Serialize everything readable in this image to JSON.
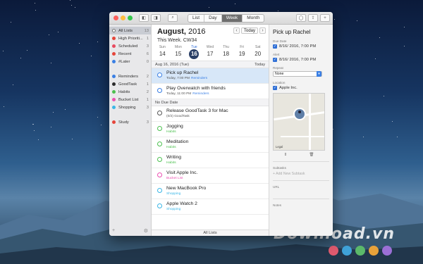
{
  "window": {
    "view_tabs": [
      "List",
      "Day",
      "Week",
      "Month"
    ],
    "active_tab": "Week"
  },
  "sidebar": {
    "items": [
      {
        "label": "All Lists",
        "count": "13",
        "color": "#ffffff",
        "active": true
      },
      {
        "label": "High Prioriti...",
        "count": "1",
        "color": "#e5453a"
      },
      {
        "label": "Scheduled",
        "count": "3",
        "color": "#e84a5f"
      },
      {
        "label": "Recent",
        "count": "6",
        "color": "#e5453a"
      },
      {
        "label": "#Later",
        "count": "0",
        "color": "#3a7fe4"
      },
      {
        "label": "Reminders",
        "count": "2",
        "color": "#3a7fe4",
        "group_start": true
      },
      {
        "label": "GoodTask",
        "count": "1",
        "color": "#2b2b2b"
      },
      {
        "label": "Habits",
        "count": "2",
        "color": "#4cc04f"
      },
      {
        "label": "Bucket List",
        "count": "1",
        "color": "#ec4fb1"
      },
      {
        "label": "Shopping",
        "count": "3",
        "color": "#3ab6e6"
      },
      {
        "label": "Study",
        "count": "3",
        "color": "#e5453a",
        "group_start": true
      }
    ],
    "add_label": "+",
    "settings_label": "⚙"
  },
  "main": {
    "month": "August,",
    "year": "2016",
    "week_label": "This Week. CW34",
    "today_label": "Today",
    "prev": "‹",
    "next": "›",
    "days": [
      {
        "name": "Sun",
        "date": "14"
      },
      {
        "name": "Mon",
        "date": "15"
      },
      {
        "name": "Tue",
        "date": "16",
        "selected": true
      },
      {
        "name": "Wed",
        "date": "17"
      },
      {
        "name": "Thu",
        "date": "18"
      },
      {
        "name": "Fri",
        "date": "19"
      },
      {
        "name": "Sat",
        "date": "20"
      }
    ],
    "section1": {
      "title": "Aug 16, 2016 (Tue)",
      "right": "Today"
    },
    "section1_tasks": [
      {
        "title": "Pick up Rachel",
        "sub": "Today, 7:00 PM",
        "tag": "Reminders",
        "tag_color": "#3a7fe4",
        "check_color": "#3a7fe4",
        "selected": true
      },
      {
        "title": "Play Overwatch with friends",
        "sub": "Today, 11:00 PM",
        "tag": "Reminders",
        "tag_color": "#3a7fe4",
        "check_color": "#3a7fe4"
      }
    ],
    "section2": {
      "title": "No Due Date"
    },
    "section2_tasks": [
      {
        "title": "Release GoodTask 3 for Mac",
        "sub": "(0/2) GoodTask",
        "tag": "",
        "tag_color": "#555555",
        "check_color": "#555555"
      },
      {
        "title": "Jogging",
        "sub": "",
        "tag": "Habits",
        "tag_color": "#4cc04f",
        "check_color": "#4cc04f"
      },
      {
        "title": "Meditation",
        "sub": "",
        "tag": "Habits",
        "tag_color": "#4cc04f",
        "check_color": "#4cc04f"
      },
      {
        "title": "Writing",
        "sub": "",
        "tag": "Habits",
        "tag_color": "#4cc04f",
        "check_color": "#4cc04f"
      },
      {
        "title": "Visit Apple Inc.",
        "sub": "",
        "tag": "Bucket List",
        "tag_color": "#ec4fb1",
        "check_color": "#ec4fb1"
      },
      {
        "title": "New MacBook Pro",
        "sub": "",
        "tag": "Shopping",
        "tag_color": "#3ab6e6",
        "check_color": "#3ab6e6"
      },
      {
        "title": "Apple Watch 2",
        "sub": "",
        "tag": "Shopping",
        "tag_color": "#3ab6e6",
        "check_color": "#3ab6e6"
      }
    ],
    "footer": "All Lists"
  },
  "detail": {
    "title": "Pick up Rachel",
    "due_label": "Due Date",
    "due_value": "8/16/ 2016,   7:00 PM",
    "alert_label": "Alert",
    "alert_value": "8/16/ 2016,   7:00 PM",
    "repeat_label": "Repeat",
    "repeat_value": "None",
    "location_label": "Location",
    "location_value": "Apple Inc.",
    "map_legal": "Legal",
    "subtasks_label": "Subtasks",
    "add_subtask": "+ Add New Subtask",
    "url_label": "URL",
    "notes_label": "Notes"
  },
  "watermark": "Download.vn",
  "dot_colors": [
    "#e05b6f",
    "#3fa2d8",
    "#5bb96a",
    "#e8a23a",
    "#9b6fd6"
  ]
}
